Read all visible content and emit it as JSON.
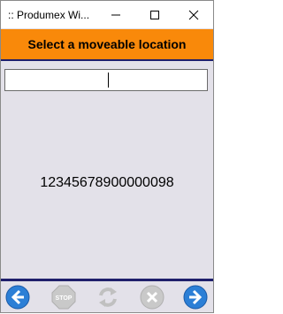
{
  "window": {
    "title": ":: Produmex Wi...",
    "controls": [
      "minimize-icon",
      "maximize-icon",
      "close-icon"
    ]
  },
  "header": {
    "title": "Select a moveable location"
  },
  "location_input": {
    "value": "",
    "placeholder": ""
  },
  "scanned_value": "12345678900000098",
  "toolbar": {
    "buttons": [
      {
        "icon": "back-arrow-icon",
        "enabled": true
      },
      {
        "icon": "stop-icon",
        "label": "STOP",
        "enabled": false
      },
      {
        "icon": "refresh-icon",
        "enabled": false
      },
      {
        "icon": "cancel-icon",
        "enabled": false
      },
      {
        "icon": "next-arrow-icon",
        "enabled": true
      }
    ],
    "accent": "#2c7fd6"
  },
  "colors": {
    "header": "#f9890a",
    "background": "#e3e1e9",
    "divider": "#1f1f6b"
  }
}
